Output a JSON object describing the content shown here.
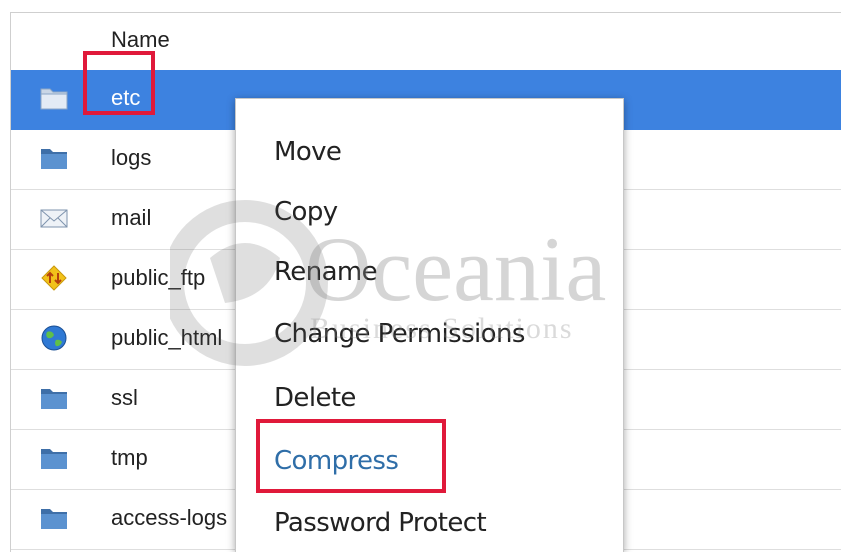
{
  "file_table": {
    "header": {
      "name_label": "Name"
    },
    "rows": [
      {
        "name": "etc",
        "icon": "folder-icon",
        "selected": true
      },
      {
        "name": "logs",
        "icon": "folder-icon",
        "selected": false
      },
      {
        "name": "mail",
        "icon": "mail-envelope-icon",
        "selected": false
      },
      {
        "name": "public_ftp",
        "icon": "ftp-icon",
        "selected": false
      },
      {
        "name": "public_html",
        "icon": "globe-icon",
        "selected": false
      },
      {
        "name": "ssl",
        "icon": "folder-icon",
        "selected": false
      },
      {
        "name": "tmp",
        "icon": "folder-icon",
        "selected": false
      },
      {
        "name": "access-logs",
        "icon": "folder-icon",
        "selected": false
      }
    ]
  },
  "context_menu": {
    "items": [
      {
        "label": "Move"
      },
      {
        "label": "Copy"
      },
      {
        "label": "Rename"
      },
      {
        "label": "Change Permissions"
      },
      {
        "label": "Delete"
      },
      {
        "label": "Compress",
        "active": true
      },
      {
        "label": "Password Protect"
      }
    ]
  },
  "watermark": {
    "brand": "Oceania",
    "tagline": "Business Solutions"
  },
  "colors": {
    "selected_row": "#3d82e0",
    "highlight_box": "#e0193a",
    "active_menu_item": "#2f6ea8",
    "folder": "#4f86c6"
  }
}
